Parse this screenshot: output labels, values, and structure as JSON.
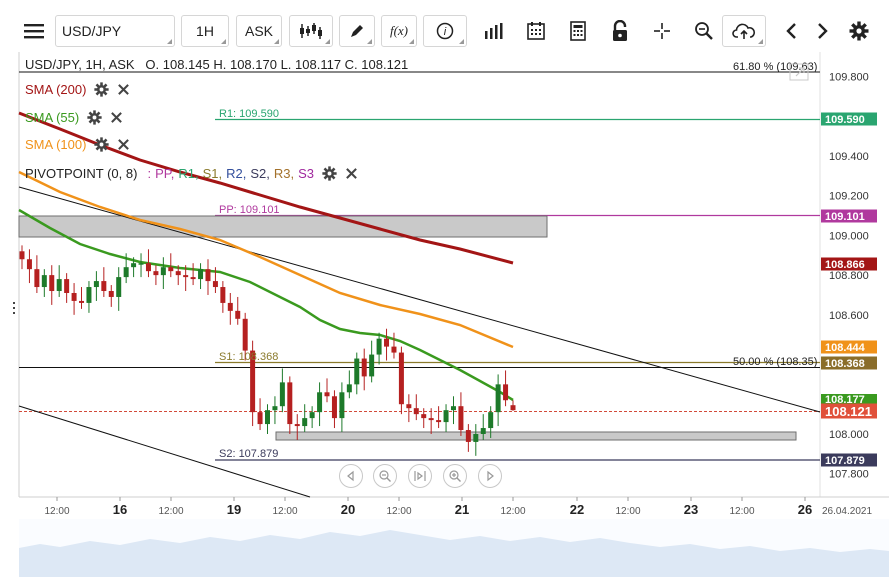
{
  "toolbar": {
    "symbol": "USD/JPY",
    "timeframe": "1H",
    "price_side": "ASK",
    "fx_label": "f(x)",
    "icons": [
      "menu-icon",
      "candlestick-icon",
      "pen-icon",
      "function-icon",
      "info-icon",
      "volume-bars-icon",
      "calendar-icon",
      "calculator-icon",
      "lock-icon",
      "crosshair-icon",
      "zoom-icon",
      "cloud-upload-icon",
      "chevron-left-icon",
      "chevron-right-icon",
      "gear-icon"
    ]
  },
  "info_line": "USD/JPY, 1H, ASK   O. 108.145 H. 108.170 L. 108.117 C. 108.121",
  "indicators": [
    {
      "label": "SMA (200)",
      "color": "#a31515"
    },
    {
      "label": "SMA (55)",
      "color": "#3a9a1f"
    },
    {
      "label": "SMA (100)",
      "color": "#f0921a"
    }
  ],
  "pivot": {
    "prefix": "PIVOTPOINT (0, 8)",
    "sep": ":",
    "items": [
      {
        "label": "PP,",
        "color": "#b0399e"
      },
      {
        "label": "R1,",
        "color": "#2aa570"
      },
      {
        "label": "S1,",
        "color": "#8a7a2c"
      },
      {
        "label": "R2,",
        "color": "#334f9c"
      },
      {
        "label": "S2,",
        "color": "#3b3b5c"
      },
      {
        "label": "R3,",
        "color": "#a3712b"
      },
      {
        "label": "S3",
        "color": "#a02a9e"
      }
    ]
  },
  "level_labels": {
    "fib_top": "61.80 % (109.63)",
    "fib_mid": "50.00 % (108.35)",
    "r1": "R1: 109.590",
    "pp": "PP: 109.101",
    "s1": "S1: 108.368",
    "s2": "S2: 107.879"
  },
  "price_axis": [
    "109.800",
    "109.600",
    "109.400",
    "109.200",
    "109.000",
    "108.800",
    "108.600",
    "108.000",
    "107.800"
  ],
  "price_tags": [
    {
      "value": "109.590",
      "color": "#2aa570"
    },
    {
      "value": "109.101",
      "color": "#b0399e"
    },
    {
      "value": "108.866",
      "color": "#a31515"
    },
    {
      "value": "108.444",
      "color": "#f0921a"
    },
    {
      "value": "108.368",
      "color": "#8a6d2a"
    },
    {
      "value": "108.177",
      "color": "#3a9a1f"
    },
    {
      "value": "108.121",
      "color": "#e0503a"
    },
    {
      "value": "107.879",
      "color": "#3b3b5c"
    }
  ],
  "hidden_tick": "108.200",
  "time_axis": [
    "12:00",
    "16",
    "12:00",
    "19",
    "12:00",
    "20",
    "12:00",
    "21",
    "12:00",
    "22",
    "12:00",
    "23",
    "12:00",
    "26",
    "26.04.2021"
  ],
  "time_axis_bold": [
    false,
    true,
    false,
    true,
    false,
    true,
    false,
    true,
    false,
    true,
    false,
    true,
    false,
    true,
    false
  ],
  "nav_icons": [
    "scroll-left-icon",
    "zoom-out-icon",
    "reset-zoom-icon",
    "zoom-in-icon",
    "scroll-right-icon"
  ],
  "colors": {
    "sma200": "#a31515",
    "sma55": "#3a9a1f",
    "sma100": "#f0921a",
    "candle_up": "#1d7a2a",
    "candle_down": "#b52020"
  },
  "chart_data": {
    "type": "candlestick",
    "symbol": "USD/JPY",
    "interval": "1H",
    "last": {
      "open": 108.145,
      "high": 108.17,
      "low": 108.117,
      "close": 108.121
    },
    "ylim": [
      107.7,
      109.9
    ],
    "x_labels": [
      "12:00",
      "16",
      "12:00",
      "19",
      "12:00",
      "20",
      "12:00",
      "21",
      "12:00",
      "22",
      "12:00",
      "23",
      "12:00",
      "26"
    ],
    "closes": [
      108.88,
      108.83,
      108.74,
      108.8,
      108.72,
      108.78,
      108.71,
      108.67,
      108.66,
      108.74,
      108.77,
      108.72,
      108.69,
      108.79,
      108.84,
      108.86,
      108.86,
      108.82,
      108.8,
      108.84,
      108.82,
      108.8,
      108.79,
      108.78,
      108.83,
      108.77,
      108.74,
      108.66,
      108.62,
      108.58,
      108.42,
      108.11,
      108.05,
      108.12,
      108.14,
      108.26,
      108.05,
      108.04,
      108.08,
      108.11,
      108.21,
      108.19,
      108.08,
      108.21,
      108.25,
      108.38,
      108.29,
      108.4,
      108.48,
      108.44,
      108.41,
      108.15,
      108.13,
      108.1,
      108.08,
      108.07,
      108.06,
      108.12,
      108.14,
      108.02,
      107.96,
      108.0,
      108.03,
      108.11,
      108.25,
      108.17,
      108.12
    ],
    "sma_200_end": 108.866,
    "sma_100_end": 108.444,
    "sma_55_end": 108.177,
    "pivots": {
      "PP": 109.101,
      "R1": 109.59,
      "S1": 108.368,
      "S2": 107.879
    },
    "fibonacci": [
      {
        "level": "61.80 %",
        "value": 109.63
      },
      {
        "level": "50.00 %",
        "value": 108.35
      }
    ]
  }
}
